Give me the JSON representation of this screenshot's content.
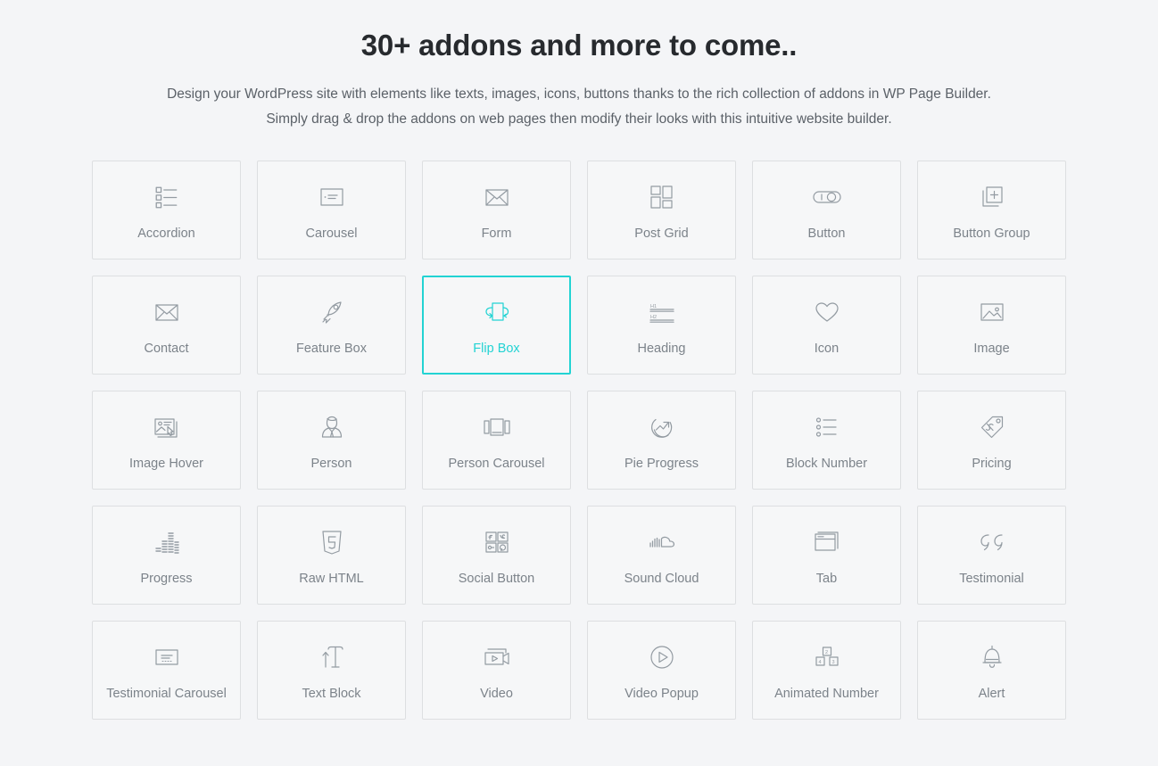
{
  "header": {
    "title": "30+ addons and more to come..",
    "subtitle": "Design your WordPress site with elements like texts, images, icons, buttons thanks to the rich collection of addons in WP Page Builder. Simply drag & drop the addons on web pages then modify their looks with this intuitive website builder."
  },
  "theme": {
    "page_background": "#f4f5f7",
    "card_background": "#f6f7f8",
    "card_border": "#dddfe1",
    "accent": "#22d3d3",
    "title_color": "#272a2e",
    "label_color": "#7c838a",
    "icon_color": "#939ba2"
  },
  "addons": [
    {
      "label": "Accordion",
      "icon": "accordion-list-icon",
      "active": false
    },
    {
      "label": "Carousel",
      "icon": "carousel-slide-icon",
      "active": false
    },
    {
      "label": "Form",
      "icon": "envelope-icon",
      "active": false
    },
    {
      "label": "Post Grid",
      "icon": "grid-blocks-icon",
      "active": false
    },
    {
      "label": "Button",
      "icon": "toggle-switch-icon",
      "active": false
    },
    {
      "label": "Button Group",
      "icon": "stacked-plus-icon",
      "active": false
    },
    {
      "label": "Contact",
      "icon": "envelope-icon",
      "active": false
    },
    {
      "label": "Feature Box",
      "icon": "rocket-icon",
      "active": false
    },
    {
      "label": "Flip Box",
      "icon": "flip-box-icon",
      "active": true
    },
    {
      "label": "Heading",
      "icon": "heading-h1-h2-icon",
      "active": false
    },
    {
      "label": "Icon",
      "icon": "heart-icon",
      "active": false
    },
    {
      "label": "Image",
      "icon": "picture-frame-icon",
      "active": false
    },
    {
      "label": "Image Hover",
      "icon": "image-cursor-icon",
      "active": false
    },
    {
      "label": "Person",
      "icon": "person-bust-icon",
      "active": false
    },
    {
      "label": "Person Carousel",
      "icon": "film-frames-icon",
      "active": false
    },
    {
      "label": "Pie Progress",
      "icon": "circle-arrow-chart-icon",
      "active": false
    },
    {
      "label": "Block Number",
      "icon": "bullet-list-icon",
      "active": false
    },
    {
      "label": "Pricing",
      "icon": "price-tag-icon",
      "active": false
    },
    {
      "label": "Progress",
      "icon": "equalizer-bars-icon",
      "active": false
    },
    {
      "label": "Raw HTML",
      "icon": "html5-shield-icon",
      "active": false
    },
    {
      "label": "Social Button",
      "icon": "social-grid-icon",
      "active": false
    },
    {
      "label": "Sound Cloud",
      "icon": "soundcloud-icon",
      "active": false
    },
    {
      "label": "Tab",
      "icon": "tab-windows-icon",
      "active": false
    },
    {
      "label": "Testimonial",
      "icon": "quote-marks-icon",
      "active": false
    },
    {
      "label": "Testimonial Carousel",
      "icon": "quote-slide-icon",
      "active": false
    },
    {
      "label": "Text Block",
      "icon": "text-cursor-t-icon",
      "active": false
    },
    {
      "label": "Video",
      "icon": "video-camera-icon",
      "active": false
    },
    {
      "label": "Video Popup",
      "icon": "play-circle-icon",
      "active": false
    },
    {
      "label": "Animated Number",
      "icon": "number-blocks-icon",
      "active": false
    },
    {
      "label": "Alert",
      "icon": "bell-icon",
      "active": false
    }
  ],
  "icon_glyph_text": {
    "heading_h1": "H1",
    "heading_h2": "H2",
    "html5_letter": "5",
    "number_two": "2",
    "number_four": "4",
    "number_three": "3"
  }
}
